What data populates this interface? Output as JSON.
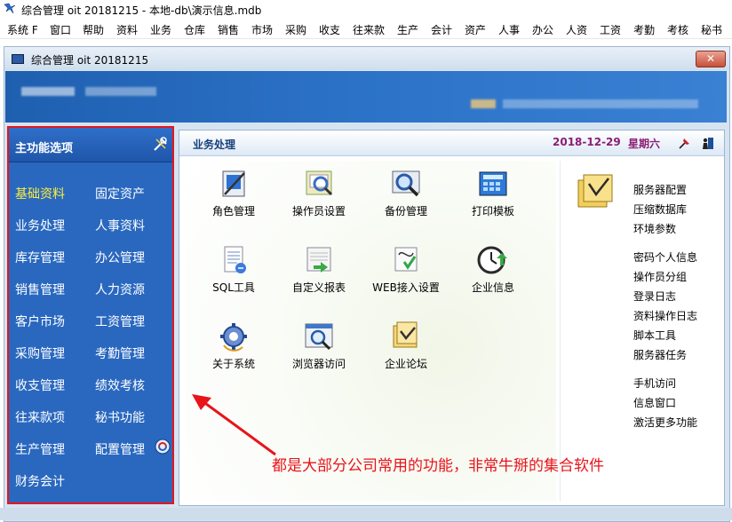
{
  "app": {
    "title": "综合管理 oit 20181215 - 本地-db\\演示信息.mdb"
  },
  "menu": [
    "系统 F",
    "窗口",
    "帮助",
    "资料",
    "业务",
    "仓库",
    "销售",
    "市场",
    "采购",
    "收支",
    "往来款",
    "生产",
    "会计",
    "资产",
    "人事",
    "办公",
    "人资",
    "工资",
    "考勤",
    "考核",
    "秘书"
  ],
  "window": {
    "title": "综合管理 oit 20181215",
    "close_label": "✕"
  },
  "left_panel": {
    "header": "主功能选项",
    "items": [
      {
        "label": "基础资料",
        "active": true
      },
      {
        "label": "固定资产"
      },
      {
        "label": "业务处理"
      },
      {
        "label": "人事资料"
      },
      {
        "label": "库存管理"
      },
      {
        "label": "办公管理"
      },
      {
        "label": "销售管理"
      },
      {
        "label": "人力资源"
      },
      {
        "label": "客户市场"
      },
      {
        "label": "工资管理"
      },
      {
        "label": "采购管理"
      },
      {
        "label": "考勤管理"
      },
      {
        "label": "收支管理"
      },
      {
        "label": "绩效考核"
      },
      {
        "label": "往来款项"
      },
      {
        "label": "秘书功能"
      },
      {
        "label": "生产管理"
      },
      {
        "label": "配置管理"
      },
      {
        "label": "财务会计"
      }
    ]
  },
  "content": {
    "title": "业务处理",
    "date": "2018-12-29",
    "weekday": "星期六",
    "modules": [
      {
        "label": "角色管理",
        "icon": "role-icon"
      },
      {
        "label": "操作员设置",
        "icon": "operator-icon"
      },
      {
        "label": "备份管理",
        "icon": "backup-icon"
      },
      {
        "label": "打印模板",
        "icon": "print-template-icon"
      },
      {
        "label": "SQL工具",
        "icon": "sql-icon"
      },
      {
        "label": "自定义报表",
        "icon": "report-icon"
      },
      {
        "label": "WEB接入设置",
        "icon": "web-icon"
      },
      {
        "label": "企业信息",
        "icon": "clock-icon"
      },
      {
        "label": "关于系统",
        "icon": "gear-icon"
      },
      {
        "label": "浏览器访问",
        "icon": "browser-icon"
      },
      {
        "label": "企业论坛",
        "icon": "forum-icon"
      }
    ],
    "system_links": [
      "服务器配置",
      "压缩数据库",
      "环境参数",
      "密码个人信息",
      "操作员分组",
      "登录日志",
      "资料操作日志",
      "脚本工具",
      "服务器任务",
      "手机访问",
      "信息窗口",
      "激活更多功能"
    ]
  },
  "annotation": "都是大部分公司常用的功能，非常牛掰的集合软件",
  "colors": {
    "panel_blue": "#2a68bf",
    "active_yellow": "#ffef3a",
    "annotation_red": "#e8141a",
    "date_purple": "#8b1e74"
  }
}
